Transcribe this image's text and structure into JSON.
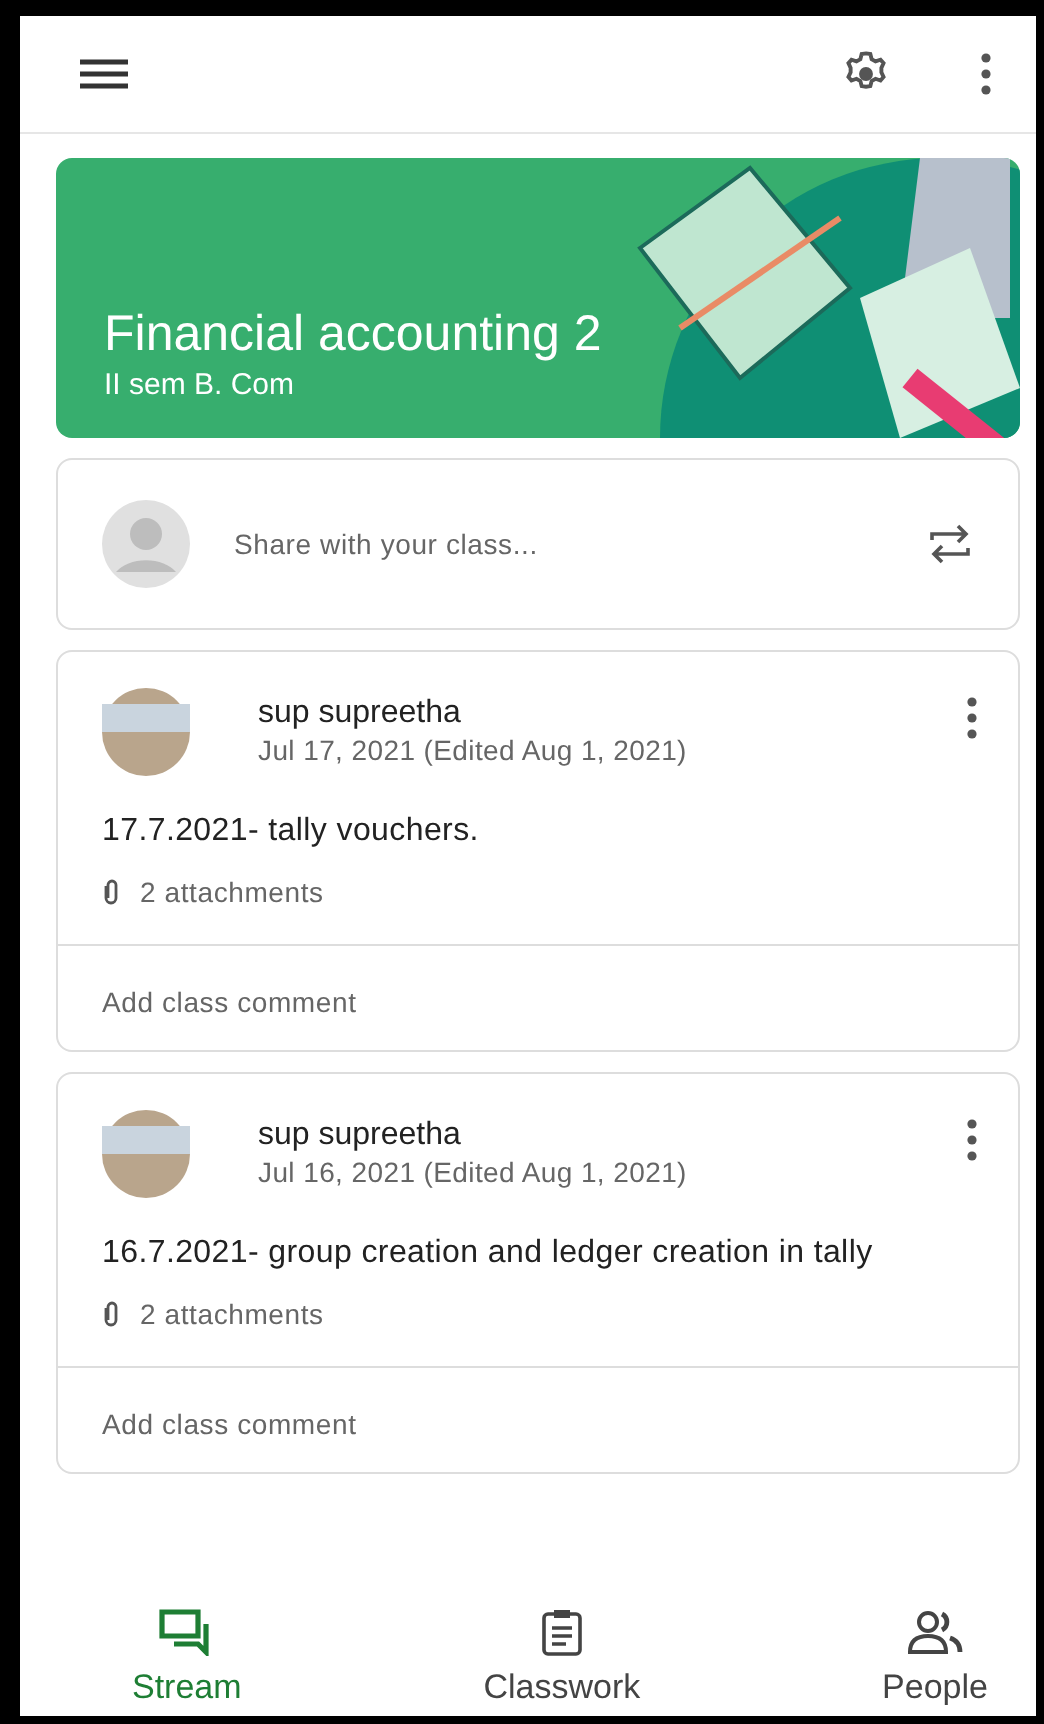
{
  "class_banner": {
    "title": "Financial accounting 2",
    "subtitle": "II sem B. Com"
  },
  "share_box": {
    "placeholder": "Share with your class..."
  },
  "posts": [
    {
      "author": "sup supreetha",
      "date": "Jul 17, 2021 (Edited Aug 1, 2021)",
      "text": "17.7.2021- tally vouchers.",
      "attachments": "2 attachments",
      "comment_placeholder": "Add class comment"
    },
    {
      "author": "sup supreetha",
      "date": "Jul 16, 2021 (Edited Aug 1, 2021)",
      "text": "16.7.2021- group creation and ledger creation in tally",
      "attachments": "2 attachments",
      "comment_placeholder": "Add class comment"
    }
  ],
  "bottom_nav": [
    {
      "kind": "stream",
      "label": "Stream",
      "selected": true
    },
    {
      "kind": "classwork",
      "label": "Classwork",
      "selected": false
    },
    {
      "kind": "people",
      "label": "People",
      "selected": false
    }
  ]
}
